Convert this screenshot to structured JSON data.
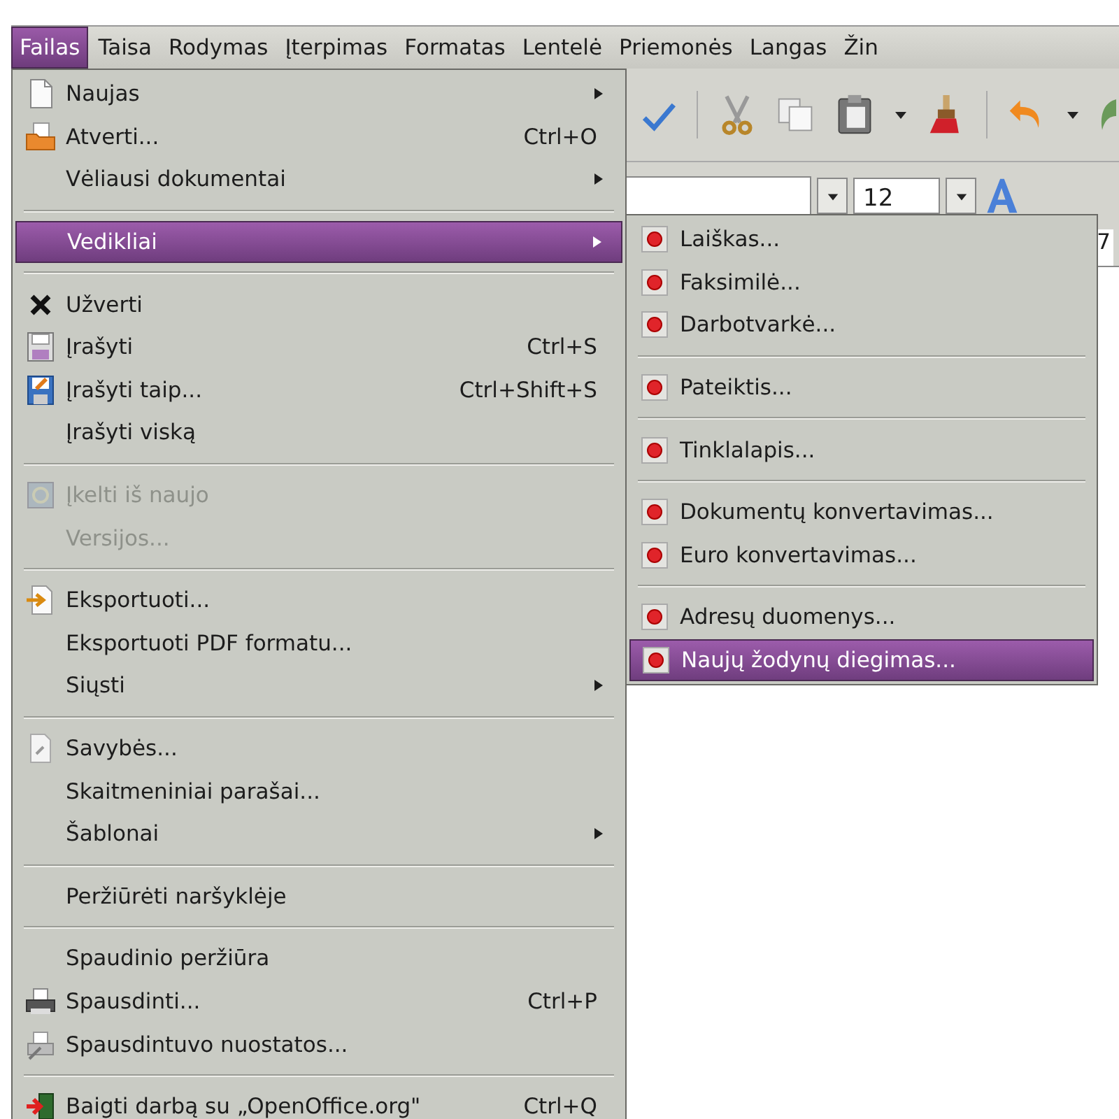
{
  "menubar": [
    {
      "label": "Failas",
      "selected": true
    },
    {
      "label": "Taisa",
      "selected": false
    },
    {
      "label": "Rodymas",
      "selected": false
    },
    {
      "label": "Įterpimas",
      "selected": false
    },
    {
      "label": "Formatas",
      "selected": false
    },
    {
      "label": "Lentelė",
      "selected": false
    },
    {
      "label": "Priemonės",
      "selected": false
    },
    {
      "label": "Langas",
      "selected": false
    },
    {
      "label": "Žin",
      "selected": false
    }
  ],
  "formatting_toolbar": {
    "font_size": "12"
  },
  "ruler": {
    "mark": "7"
  },
  "file_menu": [
    [
      {
        "label": "Naujas",
        "submenu": true,
        "disabled": false,
        "selected": false
      },
      {
        "label": "Atverti...",
        "shortcut": "Ctrl+O",
        "submenu": false,
        "disabled": false,
        "selected": false
      },
      {
        "label": "Vėliausi dokumentai",
        "submenu": true,
        "disabled": false,
        "selected": false
      }
    ],
    [
      {
        "label": "Vedikliai",
        "submenu": true,
        "disabled": false,
        "selected": true
      }
    ],
    [
      {
        "label": "Užverti",
        "submenu": false,
        "disabled": false,
        "selected": false
      },
      {
        "label": "Įrašyti",
        "shortcut": "Ctrl+S",
        "submenu": false,
        "disabled": false,
        "selected": false
      },
      {
        "label": "Įrašyti taip...",
        "shortcut": "Ctrl+Shift+S",
        "submenu": false,
        "disabled": false,
        "selected": false
      },
      {
        "label": "Įrašyti viską",
        "submenu": false,
        "disabled": false,
        "selected": false
      }
    ],
    [
      {
        "label": "Įkelti iš naujo",
        "submenu": false,
        "disabled": true,
        "selected": false
      },
      {
        "label": "Versijos...",
        "submenu": false,
        "disabled": true,
        "selected": false
      }
    ],
    [
      {
        "label": "Eksportuoti...",
        "submenu": false,
        "disabled": false,
        "selected": false
      },
      {
        "label": "Eksportuoti PDF formatu...",
        "submenu": false,
        "disabled": false,
        "selected": false
      },
      {
        "label": "Siųsti",
        "submenu": true,
        "disabled": false,
        "selected": false
      }
    ],
    [
      {
        "label": "Savybės...",
        "submenu": false,
        "disabled": false,
        "selected": false
      },
      {
        "label": "Skaitmeniniai parašai...",
        "submenu": false,
        "disabled": false,
        "selected": false
      },
      {
        "label": "Šablonai",
        "submenu": true,
        "disabled": false,
        "selected": false
      }
    ],
    [
      {
        "label": "Peržiūrėti naršyklėje",
        "submenu": false,
        "disabled": false,
        "selected": false
      }
    ],
    [
      {
        "label": "Spaudinio peržiūra",
        "submenu": false,
        "disabled": false,
        "selected": false
      },
      {
        "label": "Spausdinti...",
        "shortcut": "Ctrl+P",
        "submenu": false,
        "disabled": false,
        "selected": false
      },
      {
        "label": "Spausdintuvo nuostatos...",
        "submenu": false,
        "disabled": false,
        "selected": false
      }
    ],
    [
      {
        "label": "Baigti darbą su „OpenOffice.org\"",
        "shortcut": "Ctrl+Q",
        "submenu": false,
        "disabled": false,
        "selected": false
      }
    ]
  ],
  "wizards_submenu": [
    [
      {
        "label": "Laiškas...",
        "selected": false
      },
      {
        "label": "Faksimilė...",
        "selected": false
      },
      {
        "label": "Darbotvarkė...",
        "selected": false
      }
    ],
    [
      {
        "label": "Pateiktis...",
        "selected": false
      }
    ],
    [
      {
        "label": "Tinklalapis...",
        "selected": false
      }
    ],
    [
      {
        "label": "Dokumentų konvertavimas...",
        "selected": false
      },
      {
        "label": "Euro konvertavimas...",
        "selected": false
      }
    ],
    [
      {
        "label": "Adresų duomenys...",
        "selected": false
      },
      {
        "label": "Naujų žodynų diegimas...",
        "selected": true
      }
    ]
  ]
}
